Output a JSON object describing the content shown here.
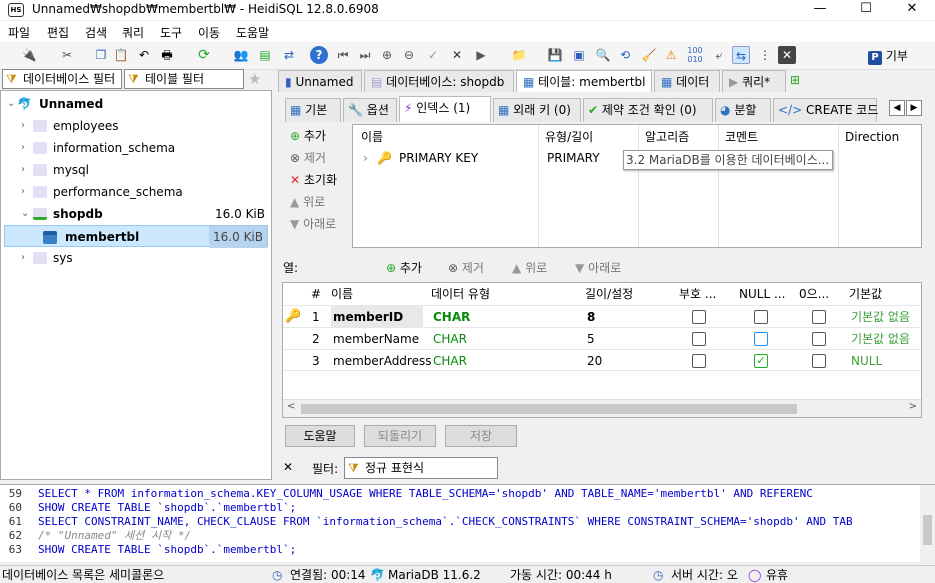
{
  "window": {
    "title": "Unnamed₩shopdb₩membertbl₩ - HeidiSQL 12.8.0.6908",
    "app_icon": "HS",
    "controls": [
      "—",
      "☐",
      "✕"
    ]
  },
  "menu": [
    "파일",
    "편집",
    "검색",
    "쿼리",
    "도구",
    "이동",
    "도움말"
  ],
  "toolbar": {
    "donate_label": "기부"
  },
  "left": {
    "db_filter_placeholder": "데이터베이스 필터",
    "table_filter_placeholder": "테이블 필터",
    "tree": {
      "root": "Unnamed",
      "dbs": [
        {
          "name": "employees"
        },
        {
          "name": "information_schema"
        },
        {
          "name": "mysql"
        },
        {
          "name": "performance_schema"
        },
        {
          "name": "shopdb",
          "size": "16.0 KiB"
        },
        {
          "name": "sys"
        }
      ],
      "selected_table": {
        "name": "membertbl",
        "size": "16.0 KiB"
      }
    }
  },
  "tabs": [
    "Unnamed",
    "데이터베이스: shopdb",
    "테이블: membertbl",
    "데이터",
    "쿼리*"
  ],
  "subtabs": [
    "기본",
    "옵션",
    "인덱스 (1)",
    "외래 키 (0)",
    "제약 조건 확인 (0)",
    "분할",
    "CREATE 코드"
  ],
  "index_panel": {
    "buttons": [
      "추가",
      "제거",
      "초기화",
      "위로",
      "아래로"
    ],
    "headers": [
      "이름",
      "유형/길이",
      "알고리즘",
      "코멘트",
      "Direction"
    ],
    "rows": [
      {
        "name": "PRIMARY KEY",
        "type": "PRIMARY"
      }
    ],
    "tooltip": "3.2 MariaDB를 이용한 데이터베이스..."
  },
  "columns_panel": {
    "label": "열:",
    "buttons": [
      "추가",
      "제거",
      "위로",
      "아래로"
    ],
    "headers": [
      "#",
      "이름",
      "데이터 유형",
      "길이/설정",
      "부호 ...",
      "NULL ...",
      "0으...",
      "기본값"
    ],
    "rows": [
      {
        "num": "1",
        "name": "memberID",
        "type": "CHAR",
        "length": "8",
        "unsigned": false,
        "null": false,
        "zerofill": false,
        "default": "기본값 없음"
      },
      {
        "num": "2",
        "name": "memberName",
        "type": "CHAR",
        "length": "5",
        "unsigned": false,
        "null": false,
        "zerofill": false,
        "default": "기본값 없음"
      },
      {
        "num": "3",
        "name": "memberAddress",
        "type": "CHAR",
        "length": "20",
        "unsigned": false,
        "null": true,
        "zerofill": false,
        "default": "NULL"
      }
    ]
  },
  "action_buttons": [
    "도움말",
    "되돌리기",
    "저장"
  ],
  "filter": {
    "close": "✕",
    "label": "필터:",
    "placeholder": "정규 표현식"
  },
  "sql_log": [
    {
      "num": "59",
      "text": "SELECT * FROM information_schema.KEY_COLUMN_USAGE WHERE   TABLE_SCHEMA='shopdb'   AND TABLE_NAME='membertbl'   AND REFERENC"
    },
    {
      "num": "60",
      "text": "SHOW CREATE TABLE `shopdb`.`membertbl`;"
    },
    {
      "num": "61",
      "text": "SELECT CONSTRAINT_NAME, CHECK_CLAUSE FROM `information_schema`.`CHECK_CONSTRAINTS` WHERE CONSTRAINT_SCHEMA='shopdb' AND TAB"
    },
    {
      "num": "62",
      "text": "/* \"Unnamed\" 세션 시작 */"
    },
    {
      "num": "63",
      "text": "SHOW CREATE TABLE `shopdb`.`membertbl`;"
    }
  ],
  "status": {
    "db_list": "데이터베이스 목록은 세미콜론으",
    "connected": "연결됨: 00:14",
    "server": "MariaDB 11.6.2",
    "uptime": "가동 시간: 00:44 h",
    "server_time": "서버 시간: 오",
    "idle": "유휴"
  },
  "colors": {
    "accent": "#0078d7",
    "selection": "#cce8ff",
    "green_text": "#3aa03a",
    "keyword": "#0000cc"
  }
}
